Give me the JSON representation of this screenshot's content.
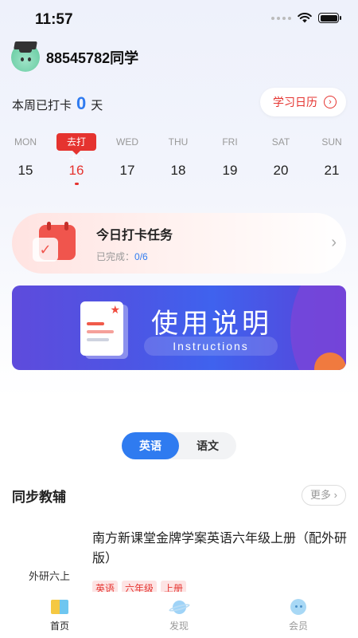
{
  "status_bar": {
    "time": "11:57"
  },
  "user": {
    "name": "88545782同学"
  },
  "week_summary": {
    "prefix": "本周已打卡",
    "count": "0",
    "suffix": "天"
  },
  "calendar_button": {
    "label": "学习日历",
    "icon": "arrow-circle-right-icon"
  },
  "week": {
    "checkin_tag": "去打卡 ›",
    "days": [
      {
        "name": "MON",
        "date": "15"
      },
      {
        "name": "",
        "date": "16",
        "active": true
      },
      {
        "name": "WED",
        "date": "17"
      },
      {
        "name": "THU",
        "date": "18"
      },
      {
        "name": "FRI",
        "date": "19"
      },
      {
        "name": "SAT",
        "date": "20"
      },
      {
        "name": "SUN",
        "date": "21"
      }
    ]
  },
  "task_card": {
    "title": "今日打卡任务",
    "status_label": "已完成：",
    "progress": "0/6"
  },
  "banner": {
    "title": "使用说明",
    "subtitle": "Instructions"
  },
  "subject_tabs": [
    {
      "label": "英语",
      "active": true
    },
    {
      "label": "语文",
      "active": false
    }
  ],
  "section": {
    "title": "同步教辅",
    "more_label": "更多 ›"
  },
  "book": {
    "cover_label": "外研六上",
    "title": "南方新课堂金牌学案英语六年级上册（配外研版）",
    "tags": [
      "英语",
      "六年级",
      "上册"
    ]
  },
  "tab_bar": [
    {
      "label": "首页",
      "icon": "home-book-icon",
      "active": true
    },
    {
      "label": "发现",
      "icon": "planet-icon",
      "active": false
    },
    {
      "label": "会员",
      "icon": "member-face-icon",
      "active": false
    }
  ],
  "colors": {
    "accent_red": "#e5332f",
    "accent_blue": "#2f7bf0"
  }
}
